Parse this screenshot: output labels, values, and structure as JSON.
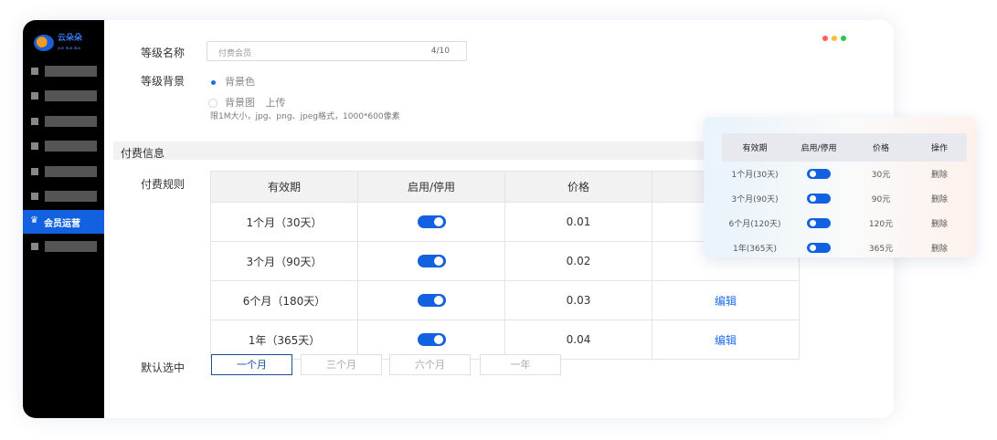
{
  "logo": {
    "text": "云朵朵",
    "sub": "yun duo duo"
  },
  "sidebar": {
    "active_label": "会员运营"
  },
  "window_dots": [
    "#ff5f57",
    "#febc2e",
    "#28c840"
  ],
  "form": {
    "level_name_label": "等级名称",
    "level_name_placeholder": "付费会员",
    "level_name_count": "4/10",
    "level_bg_label": "等级背景",
    "bg_option_color": "背景色",
    "bg_option_image": "背景图",
    "upload_label": "上传",
    "upload_hint": "限1M大小，jpg、png、jpeg格式，1000*600像素"
  },
  "section": {
    "title": "付费信息"
  },
  "rules": {
    "label": "付费规则",
    "headers": [
      "有效期",
      "启用/停用",
      "价格",
      ""
    ],
    "rows": [
      {
        "period": "1个月（30天）",
        "enabled": true,
        "price": "0.01",
        "action": ""
      },
      {
        "period": "3个月（90天）",
        "enabled": true,
        "price": "0.02",
        "action": ""
      },
      {
        "period": "6个月（180天）",
        "enabled": true,
        "price": "0.03",
        "action": "编辑"
      },
      {
        "period": "1年（365天）",
        "enabled": true,
        "price": "0.04",
        "action": "编辑"
      }
    ]
  },
  "default_select": {
    "label": "默认选中",
    "options": [
      "一个月",
      "三个月",
      "六个月",
      "一年"
    ],
    "selected": "一个月"
  },
  "popup": {
    "headers": [
      "有效期",
      "启用/停用",
      "价格",
      "操作"
    ],
    "rows": [
      {
        "period": "1个月(30天)",
        "enabled": true,
        "price": "30元",
        "action": "删除"
      },
      {
        "period": "3个月(90天)",
        "enabled": true,
        "price": "90元",
        "action": "删除"
      },
      {
        "period": "6个月(120天)",
        "enabled": true,
        "price": "120元",
        "action": "删除"
      },
      {
        "period": "1年(365天)",
        "enabled": true,
        "price": "365元",
        "action": "删除"
      }
    ]
  },
  "colors": {
    "accent": "#1261e0",
    "sidebar": "#000000"
  }
}
